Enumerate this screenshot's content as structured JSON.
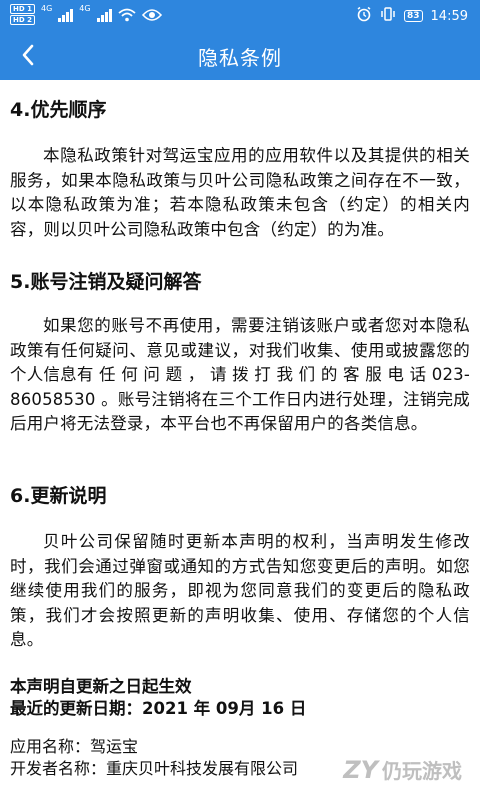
{
  "status_bar": {
    "sim1": "HD 1",
    "sim2": "HD 2",
    "net1": "4G",
    "net2": "4G",
    "battery": "83",
    "time": "14:59"
  },
  "header": {
    "title": "隐私条例",
    "back_icon": "chevron-left-icon"
  },
  "sections": [
    {
      "heading": "4.优先顺序",
      "body": "本隐私政策针对驾运宝应用的应用软件以及其提供的相关服务，如果本隐私政策与贝叶公司隐私政策之间存在不一致，以本隐私政策为准；若本隐私政策未包含（约定）的相关内容，则以贝叶公司隐私政策中包含（约定）的为准。"
    },
    {
      "heading": "5.账号注销及疑问解答",
      "body": "如果您的账号不再使用，需要注销该账户或者您对本隐私政策有任何疑问、意见或建议，对我们收集、使用或披露您的个人信息有 任 何 问 题 ， 请 拨 打 我 们 的 客 服 电 话 023-86058530 。账号注销将在三个工作日内进行处理，注销完成后用户将无法登录，本平台也不再保留用户的各类信息。"
    },
    {
      "heading": "6.更新说明",
      "body": "贝叶公司保留随时更新本声明的权利，当声明发生修改时，我们会通过弹窗或通知的方式告知您变更后的声明。如您继续使用我们的服务，即视为您同意我们的变更后的隐私政策，我们才会按照更新的声明收集、使用、存储您的个人信息。"
    }
  ],
  "effective": {
    "line1": "本声明自更新之日起生效",
    "line2": "最近的更新日期：2021 年 09月 16 日"
  },
  "app_info": {
    "app_name": "应用名称：驾运宝",
    "developer": "开发者名称：重庆贝叶科技发展有限公司"
  },
  "watermark": {
    "logo": "ZY",
    "text": "仍玩游戏"
  }
}
